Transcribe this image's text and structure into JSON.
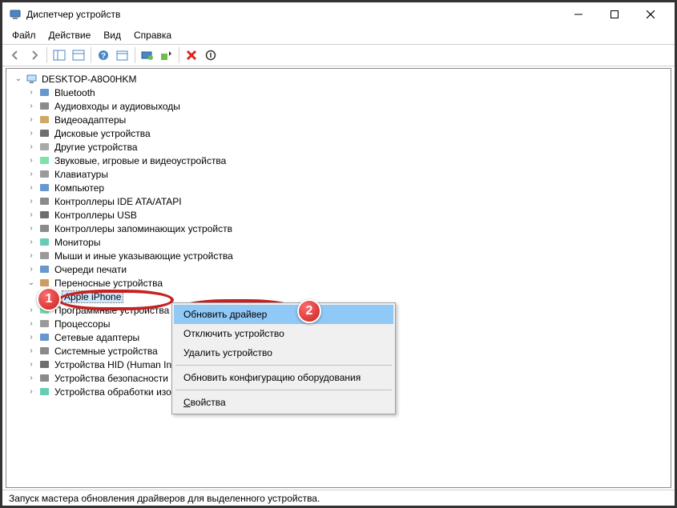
{
  "window_title": "Диспетчер устройств",
  "menu": {
    "file": "Файл",
    "action": "Действие",
    "view": "Вид",
    "help": "Справка"
  },
  "root_node": "DESKTOP-A8O0HKM",
  "categories": [
    "Bluetooth",
    "Аудиовходы и аудиовыходы",
    "Видеоадаптеры",
    "Дисковые устройства",
    "Другие устройства",
    "Звуковые, игровые и видеоустройства",
    "Клавиатуры",
    "Компьютер",
    "Контроллеры IDE ATA/ATAPI",
    "Контроллеры USB",
    "Контроллеры запоминающих устройств",
    "Мониторы",
    "Мыши и иные указывающие устройства",
    "Очереди печати",
    "Переносные устройства"
  ],
  "selected_device": "Apple iPhone",
  "categories_after": [
    "Программные устройства",
    "Процессоры",
    "Сетевые адаптеры",
    "Системные устройства",
    "Устройства HID (Human Interface Devices)",
    "Устройства безопасности",
    "Устройства обработки изображений"
  ],
  "context_menu": {
    "update_driver": "Обновить драйвер",
    "disable": "Отключить устройство",
    "uninstall": "Удалить устройство",
    "scan": "Обновить конфигурацию оборудования",
    "properties_prefix": "С",
    "properties_rest": "войства"
  },
  "status_text": "Запуск мастера обновления драйверов для выделенного устройства.",
  "icons": {
    "root": "computer-icon",
    "default": "device-icon"
  },
  "badges": {
    "one": "1",
    "two": "2"
  }
}
